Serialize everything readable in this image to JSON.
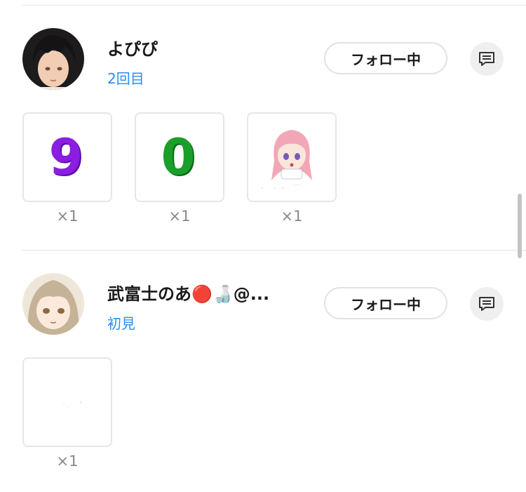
{
  "entries": [
    {
      "username": "よぴぴ",
      "visit_label": "2回目",
      "follow_label": "フォロー中",
      "items": [
        {
          "glyph": "9",
          "color": "#8b1ee0",
          "count": "×1"
        },
        {
          "glyph": "0",
          "color": "#1aa02a",
          "count": "×1"
        },
        {
          "sticker_text": "ぽいぽーおぇ",
          "count": "×1"
        }
      ]
    },
    {
      "username": "武富士のあ🔴🍶@...",
      "visit_label": "初見",
      "follow_label": "フォロー中",
      "items": [
        {
          "sticker_text": "またくるよ",
          "count": "×1"
        }
      ]
    }
  ]
}
